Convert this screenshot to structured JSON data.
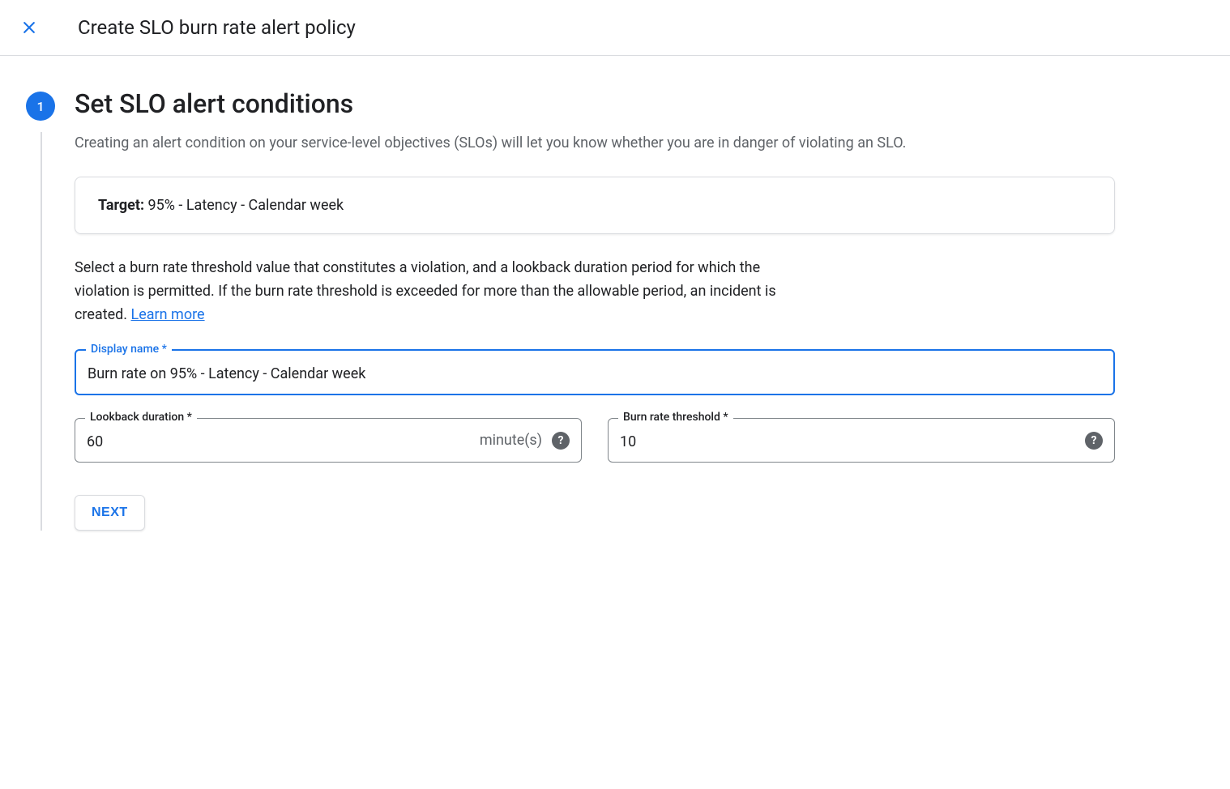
{
  "header": {
    "title": "Create SLO burn rate alert policy"
  },
  "step": {
    "number": "1",
    "title": "Set SLO alert conditions",
    "description": "Creating an alert condition on your service-level objectives (SLOs) will let you know whether you are in danger of violating an SLO.",
    "target_label": "Target:",
    "target_value": " 95% - Latency - Calendar week",
    "instruction": "Select a burn rate threshold value that constitutes a violation, and a lookback duration period for which the violation is permitted. If the burn rate threshold is exceeded for more than the allowable period, an incident is created. ",
    "learn_more": "Learn more"
  },
  "fields": {
    "display_name": {
      "label": "Display name *",
      "value": "Burn rate on 95% - Latency - Calendar week"
    },
    "lookback": {
      "label": "Lookback duration *",
      "value": "60",
      "suffix": "minute(s)"
    },
    "threshold": {
      "label": "Burn rate threshold *",
      "value": "10"
    }
  },
  "buttons": {
    "next": "NEXT"
  }
}
